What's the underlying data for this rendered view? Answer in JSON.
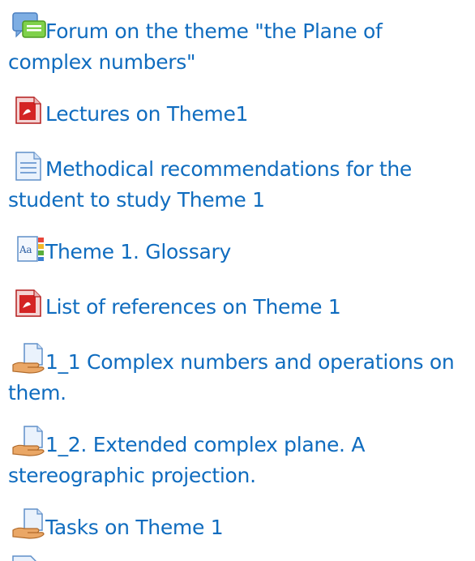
{
  "activities": [
    {
      "icon": "forum-icon",
      "label": "Forum on the theme \"the Plane of complex numbers\""
    },
    {
      "icon": "pdf-icon",
      "label": "Lectures on Theme1"
    },
    {
      "icon": "document-icon",
      "label": "Methodical recommendations for the student to study Theme 1"
    },
    {
      "icon": "glossary-icon",
      "label": "Theme 1. Glossary"
    },
    {
      "icon": "pdf-icon",
      "label": "List of references on Theme 1"
    },
    {
      "icon": "assignment-icon",
      "label": "1_1 Complex numbers and operations on them."
    },
    {
      "icon": "assignment-icon",
      "label": "1_2. Extended complex plane. A stereographic projection."
    },
    {
      "icon": "assignment-icon",
      "label": "Tasks on Theme 1"
    }
  ],
  "colors": {
    "link": "#0f6cbf",
    "icon_blue": "#5f97d6",
    "icon_green": "#6bbd3a",
    "pdf_red": "#c81e1e",
    "hand": "#e8a35a"
  }
}
